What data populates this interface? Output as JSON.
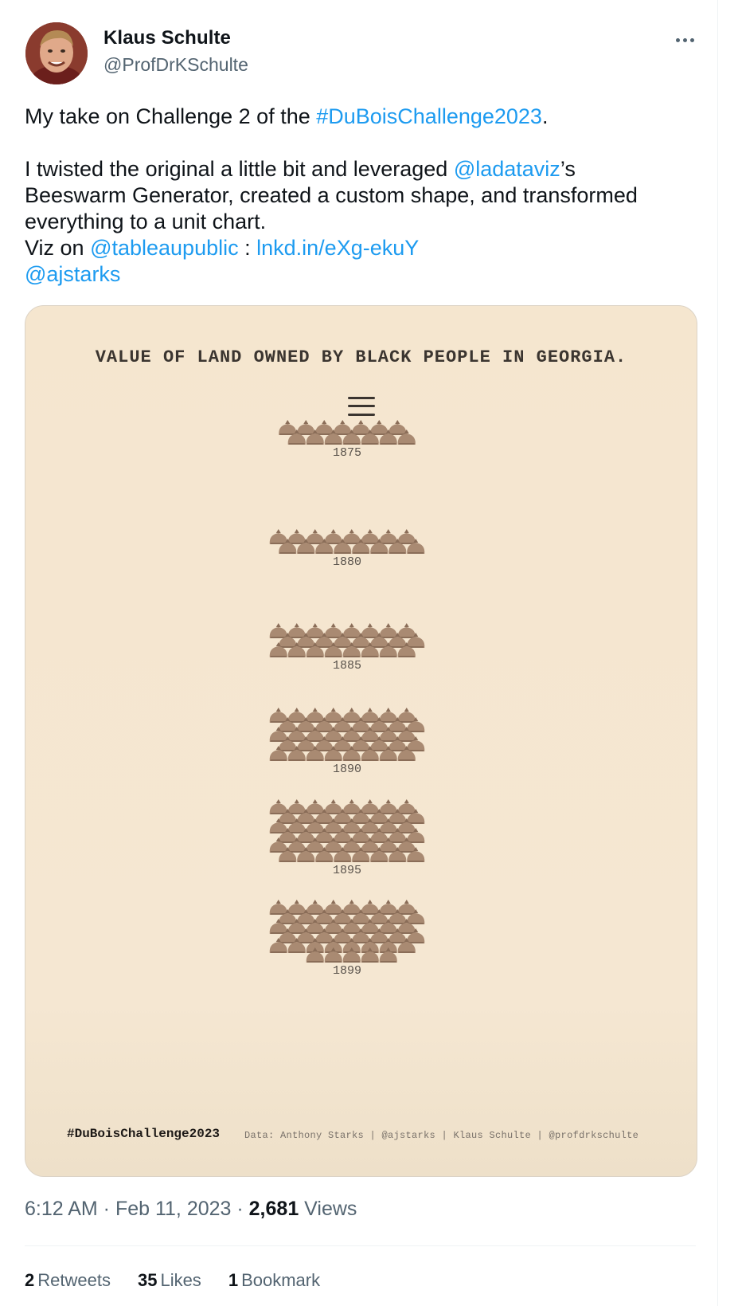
{
  "author": {
    "name": "Klaus Schulte",
    "handle": "@ProfDrKSchulte",
    "avatar_icon": "profile-photo"
  },
  "tweet": {
    "line1_pre": "My take on Challenge 2 of the ",
    "line1_hashtag": "#DuBoisChallenge2023",
    "line1_post": ".",
    "line2_pre": "I twisted the original a little bit and leveraged ",
    "line2_mention": "@ladataviz",
    "line2_post": "’s",
    "line3": "Beeswarm Generator, created a custom shape, and transformed",
    "line4": "everything to a unit chart.",
    "line5_pre": "Viz on ",
    "line5_mention": "@tableaupublic",
    "line5_mid": " : ",
    "line5_link": "lnkd.in/eXg-ekuY",
    "line6_mention": "@ajstarks"
  },
  "media": {
    "title": "VALUE OF LAND OWNED BY BLACK PEOPLE IN GEORGIA.",
    "menu_icon": "hamburger-menu-icon",
    "unit_icon": "money-bag-icon",
    "footer_tag": "#DuBoisChallenge2023",
    "footer_credit": "Data: Anthony Starks | @ajstarks | Klaus Schulte | @profdrkschulte",
    "colors": {
      "background": "#f5e6cf",
      "bag": "#a98a72",
      "bag_dark": "#8a6d58"
    }
  },
  "chart_data": {
    "type": "beeswarm",
    "title": "VALUE OF LAND OWNED BY BLACK PEOPLE IN GEORGIA.",
    "unit": "money bag",
    "categories": [
      "1875",
      "1880",
      "1885",
      "1890",
      "1895",
      "1899"
    ],
    "values": [
      14,
      16,
      24,
      40,
      48,
      45
    ]
  },
  "meta": {
    "time": "6:12 AM",
    "sep": " · ",
    "date": "Feb 11, 2023",
    "views_count": "2,681",
    "views_label": " Views"
  },
  "stats": {
    "retweets_count": "2",
    "retweets_label": "Retweets",
    "likes_count": "35",
    "likes_label": "Likes",
    "bookmarks_count": "1",
    "bookmarks_label": "Bookmark"
  }
}
